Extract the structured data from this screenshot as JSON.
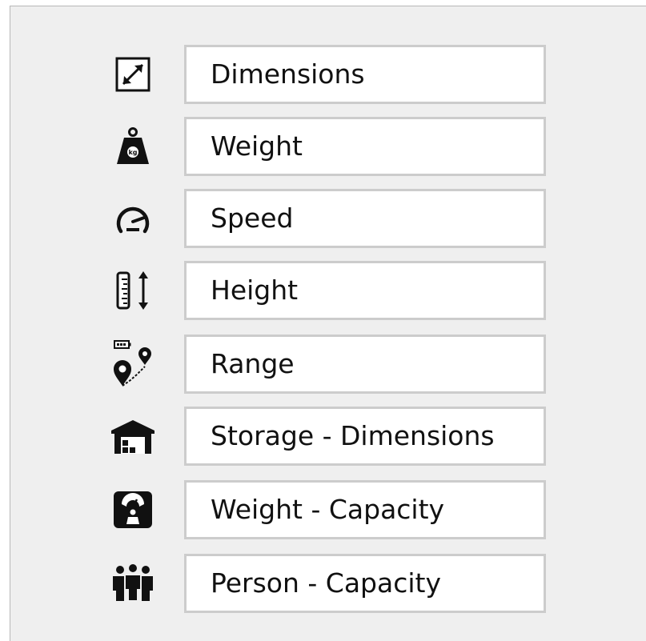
{
  "items": [
    {
      "label": "Dimensions",
      "icon": "resize-arrows-icon"
    },
    {
      "label": "Weight",
      "icon": "kg-weight-icon"
    },
    {
      "label": "Speed",
      "icon": "speedometer-icon"
    },
    {
      "label": "Height",
      "icon": "ruler-height-icon"
    },
    {
      "label": "Range",
      "icon": "battery-route-pins-icon"
    },
    {
      "label": "Storage - Dimensions",
      "icon": "warehouse-icon"
    },
    {
      "label": "Weight - Capacity",
      "icon": "scale-icon"
    },
    {
      "label": "Person - Capacity",
      "icon": "people-group-icon"
    }
  ],
  "colors": {
    "panel_background": "#efefef",
    "box_border": "#cccccc",
    "text": "#111111",
    "icon": "#111111"
  }
}
